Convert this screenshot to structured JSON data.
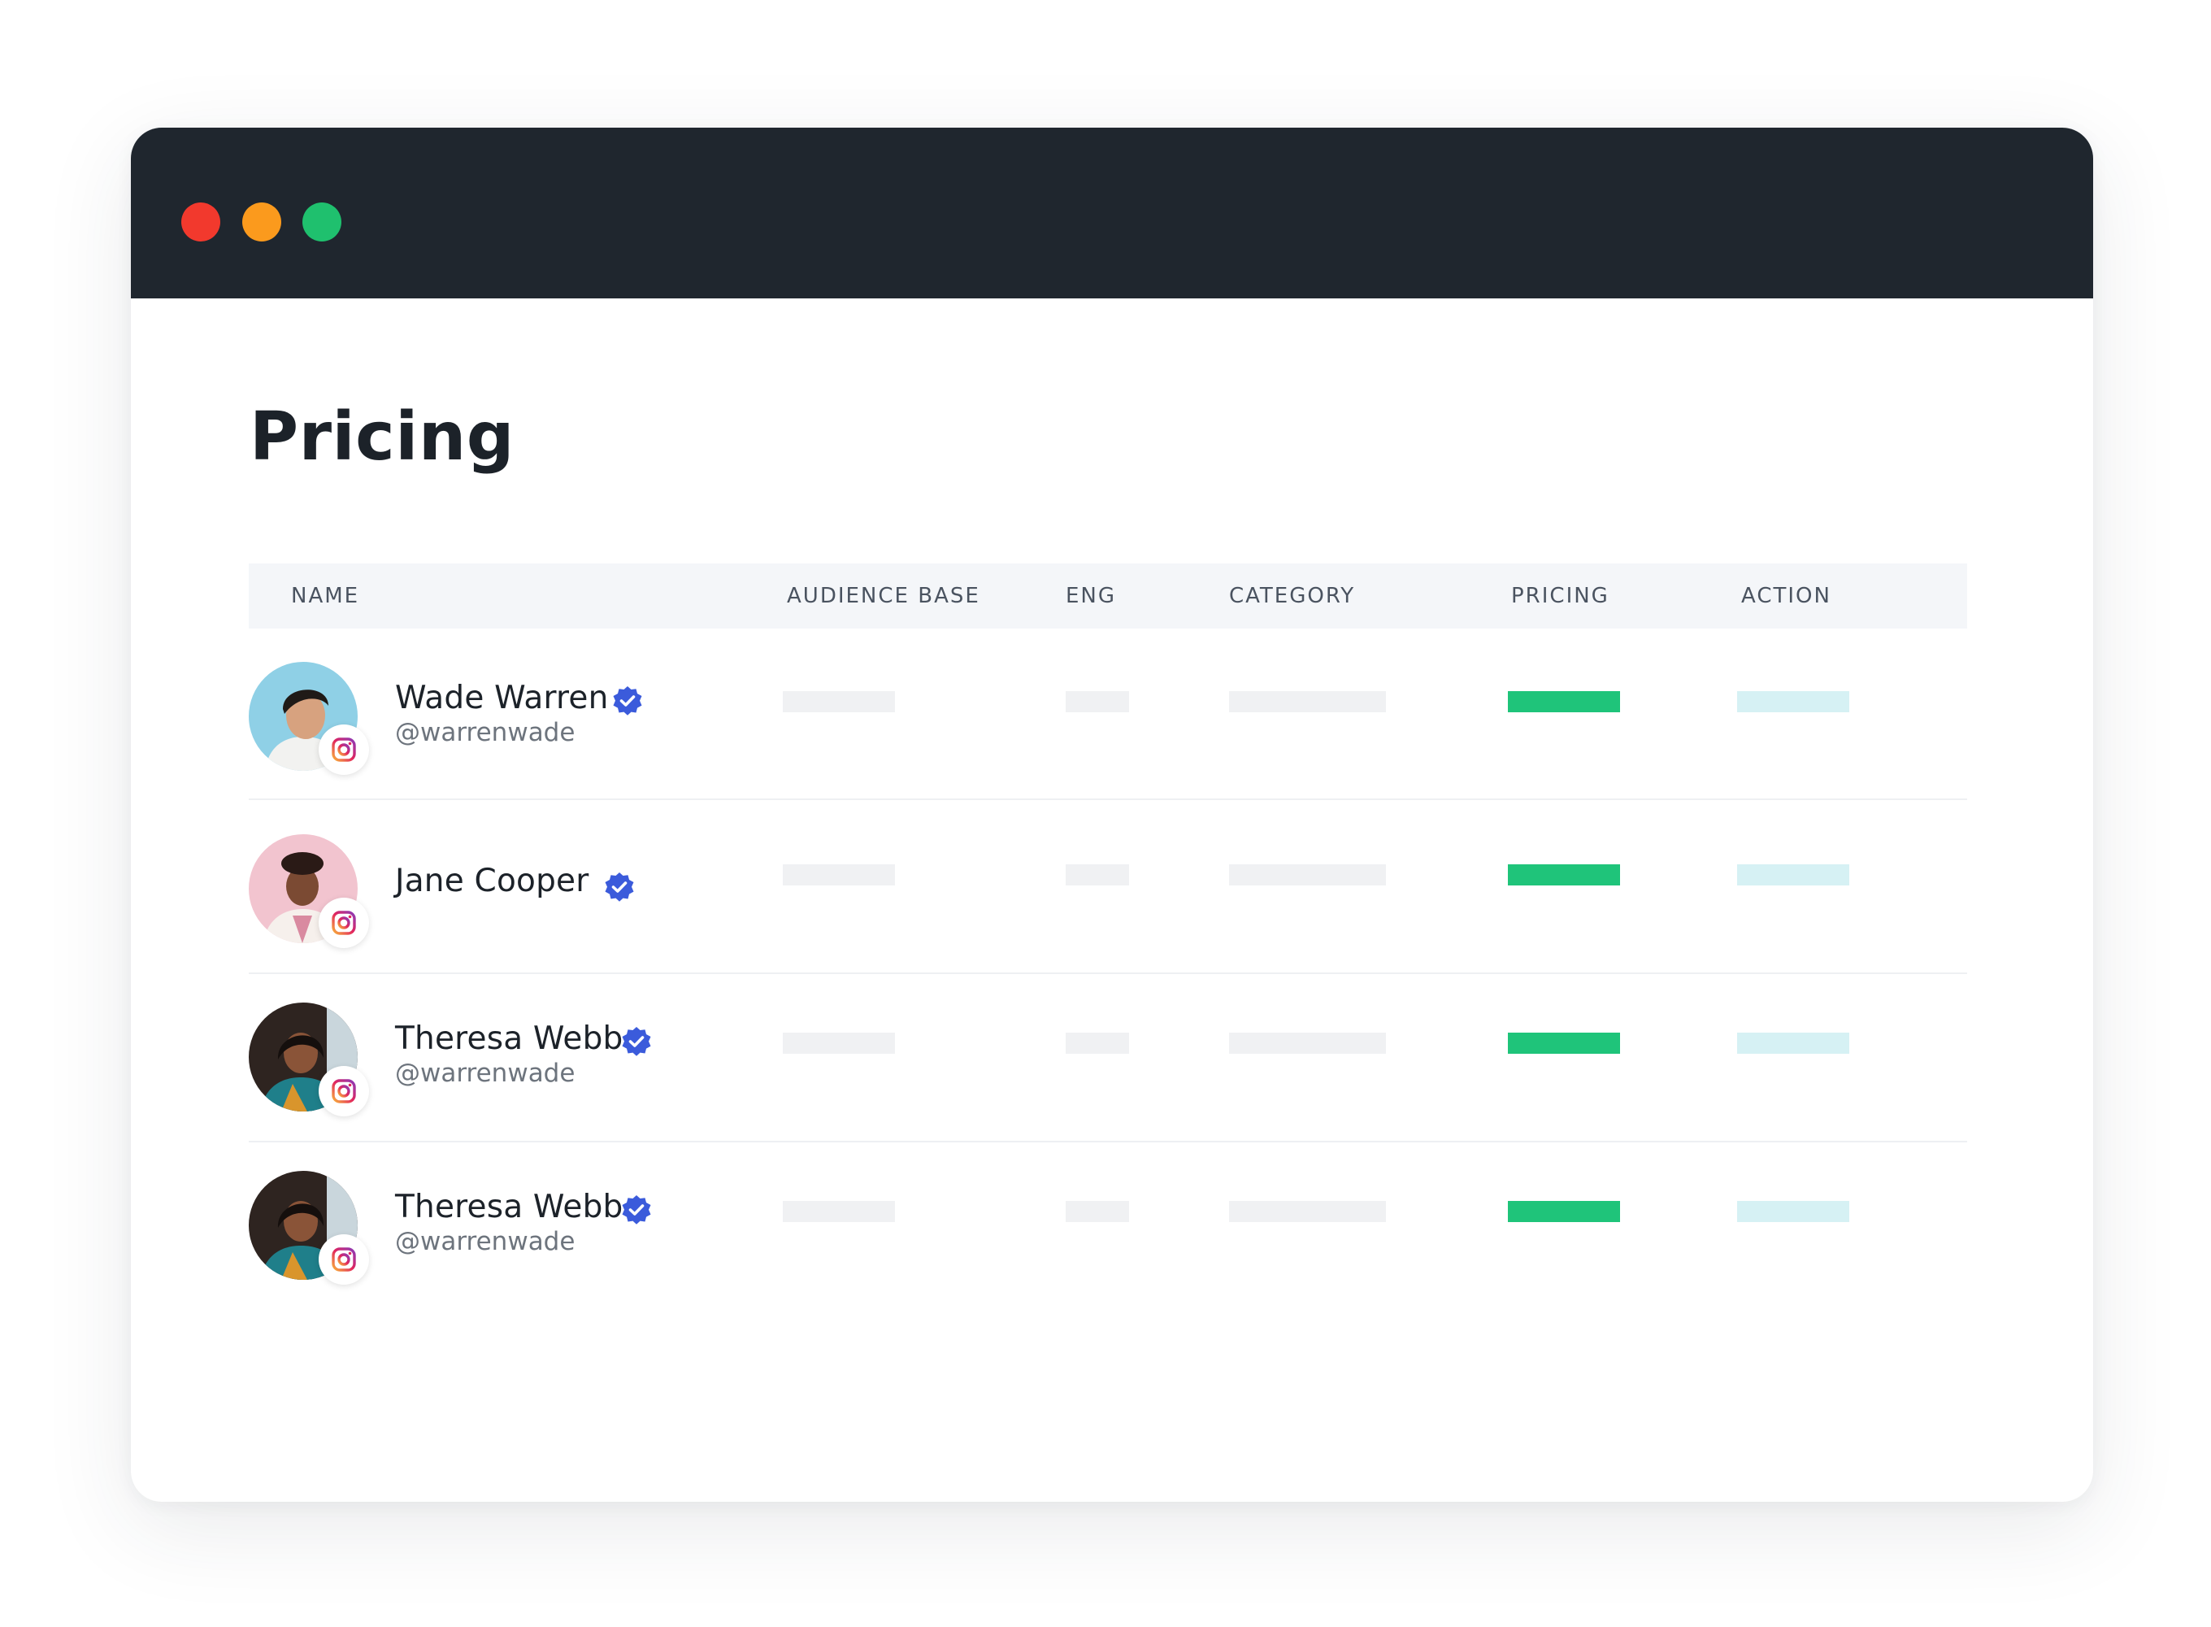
{
  "window": {
    "controls": [
      {
        "name": "close",
        "color": "#f2392d"
      },
      {
        "name": "minimize",
        "color": "#fb9a1d"
      },
      {
        "name": "maximize",
        "color": "#1fc06e"
      }
    ]
  },
  "page": {
    "title": "Pricing"
  },
  "table": {
    "columns": [
      "NAME",
      "AUDIENCE BASE",
      "ENG",
      "CATEGORY",
      "PRICING",
      "ACTION"
    ],
    "rows": [
      {
        "name": "Wade Warren",
        "handle": "@warrenwade",
        "platform_icon": "instagram-icon",
        "verified_icon": "verified-badge-icon"
      },
      {
        "name": "Jane Cooper",
        "handle": "",
        "platform_icon": "instagram-icon",
        "verified_icon": "verified-badge-icon"
      },
      {
        "name": "Theresa Webb",
        "handle": "@warrenwade",
        "platform_icon": "instagram-icon",
        "verified_icon": "verified-badge-icon"
      },
      {
        "name": "Theresa Webb",
        "handle": "@warrenwade",
        "platform_icon": "instagram-icon",
        "verified_icon": "verified-badge-icon"
      }
    ]
  },
  "colors": {
    "titlebar": "#1f262e",
    "pricing_bar": "#1fc47a",
    "action_bar": "#d6f1f4",
    "placeholder_bar": "#f0f1f3",
    "verified": "#3b5bdb"
  }
}
